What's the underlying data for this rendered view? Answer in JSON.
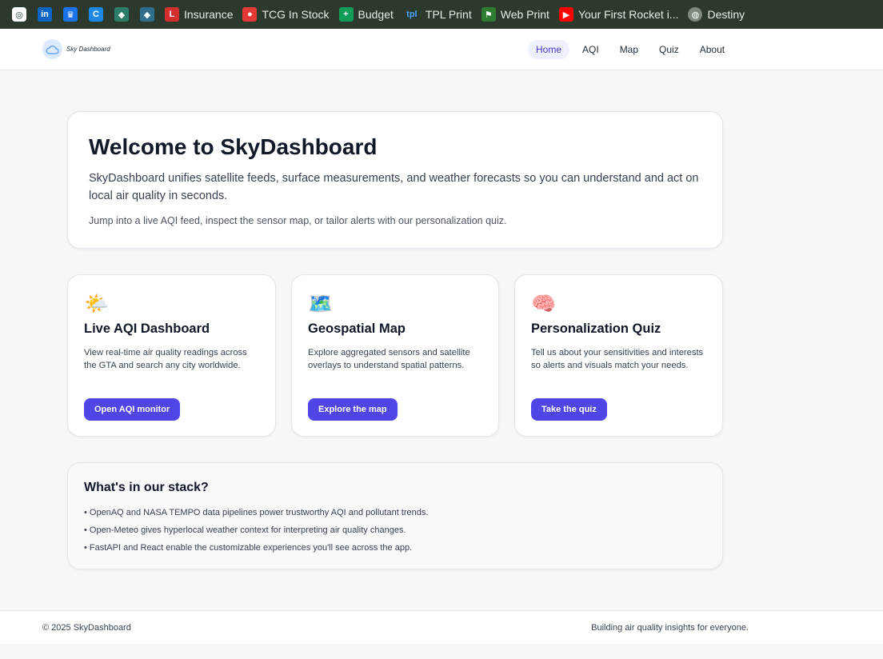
{
  "bookmarks": [
    {
      "icon": "app-icon",
      "label": "",
      "color": "#ffffff",
      "glyph": "◎"
    },
    {
      "icon": "linkedin-icon",
      "label": "",
      "color": "#0a66c2",
      "glyph": "in"
    },
    {
      "icon": "crown-icon",
      "label": "",
      "color": "#1a73e8",
      "glyph": "♛"
    },
    {
      "icon": "c-icon",
      "label": "",
      "color": "#1e88e5",
      "glyph": "C"
    },
    {
      "icon": "ethereum-icon",
      "label": "",
      "color": "#2e7d6b",
      "glyph": "◆"
    },
    {
      "icon": "ethereum-icon-2",
      "label": "",
      "color": "#2e6f8e",
      "glyph": "◆"
    },
    {
      "icon": "life-icon",
      "label": "Insurance",
      "color": "#d32f2f",
      "glyph": "L"
    },
    {
      "icon": "pokeball-icon",
      "label": "TCG In Stock",
      "color": "#e53935",
      "glyph": "●"
    },
    {
      "icon": "sheets-icon",
      "label": "Budget",
      "color": "#0f9d58",
      "glyph": "+"
    },
    {
      "icon": "tpl-icon",
      "label": "TPL Print",
      "color": "#2b3a2c",
      "glyph": "tpl"
    },
    {
      "icon": "flag-icon",
      "label": "Web Print",
      "color": "#2e7d32",
      "glyph": "⚑"
    },
    {
      "icon": "youtube-icon",
      "label": "Your First Rocket i...",
      "color": "#ff0000",
      "glyph": "▶"
    },
    {
      "icon": "globe-icon",
      "label": "Destiny",
      "color": "#7b8a7c",
      "glyph": "◍"
    }
  ],
  "header": {
    "logo_text": "Sky Dashboard",
    "nav": [
      "Home",
      "AQI",
      "Map",
      "Quiz",
      "About"
    ],
    "active_nav": "Home"
  },
  "hero": {
    "title": "Welcome to SkyDashboard",
    "lead": "SkyDashboard unifies satellite feeds, surface measurements, and weather forecasts so you can understand and act on local air quality in seconds.",
    "sub": "Jump into a live AQI feed, inspect the sensor map, or tailor alerts with our personalization quiz."
  },
  "features": [
    {
      "emoji": "🌤️",
      "title": "Live AQI Dashboard",
      "desc": "View real-time air quality readings across the GTA and search any city worldwide.",
      "button": "Open AQI monitor"
    },
    {
      "emoji": "🗺️",
      "title": "Geospatial Map",
      "desc": "Explore aggregated sensors and satellite overlays to understand spatial patterns.",
      "button": "Explore the map"
    },
    {
      "emoji": "🧠",
      "title": "Personalization Quiz",
      "desc": "Tell us about your sensitivities and interests so alerts and visuals match your needs.",
      "button": "Take the quiz"
    }
  ],
  "stack": {
    "title": "What's in our stack?",
    "items": [
      "• OpenAQ and NASA TEMPO data pipelines power trustworthy AQI and pollutant trends.",
      "• Open-Meteo gives hyperlocal weather context for interpreting air quality changes.",
      "• FastAPI and React enable the customizable experiences you'll see across the app."
    ]
  },
  "footer": {
    "copyright": "© 2025 SkyDashboard",
    "tagline": "Building air quality insights for everyone."
  },
  "colors": {
    "accent": "#4f46e5",
    "bookmark_bar": "#2b3a2c"
  }
}
